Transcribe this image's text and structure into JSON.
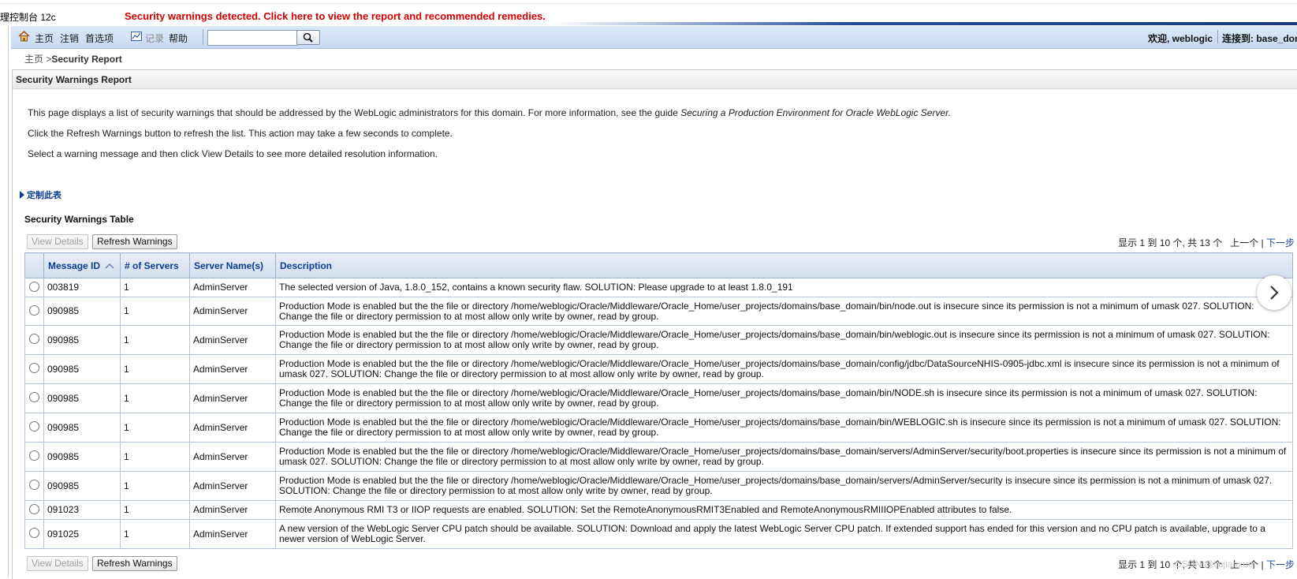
{
  "app": {
    "title": "理控制台 12c",
    "security_alert": "Security warnings detected. Click here to view the report and recommended remedies."
  },
  "menubar": {
    "home": "主页",
    "logout": "注销",
    "preferences": "首选项",
    "record": "记录",
    "help": "帮助",
    "search_value": "",
    "welcome": "欢迎, weblogic",
    "connected": "连接到: base_domain"
  },
  "breadcrumb": {
    "home": "主页",
    "sep": ">",
    "current": "Security Report"
  },
  "panel": {
    "title": "Security Warnings Report"
  },
  "intro": {
    "line1_prefix": "This page displays a list of security warnings that should be addressed by the WebLogic administrators for this domain. For more information, see the guide ",
    "line1_guide": "Securing a Production Environment for Oracle WebLogic Server.",
    "line2": "Click the Refresh Warnings button to refresh the list. This action may take a few seconds to complete.",
    "line3": "Select a warning message and then click View Details to see more detailed resolution information."
  },
  "customize": "定制此表",
  "table": {
    "title": "Security Warnings Table",
    "view_details": "View Details",
    "refresh": "Refresh Warnings",
    "pager_info": "显示 1 到 10 个, 共 13 个",
    "prev": "上一个",
    "pager_sep": "|",
    "next": "下一步",
    "headers": {
      "message_id": "Message ID",
      "servers": "# of Servers",
      "server_names": "Server Name(s)",
      "description": "Description"
    },
    "rows": [
      {
        "id": "003819",
        "servers": "1",
        "server": "AdminServer",
        "desc": "The selected version of Java, 1.8.0_152, contains a known security flaw. SOLUTION: Please upgrade to at least 1.8.0_191"
      },
      {
        "id": "090985",
        "servers": "1",
        "server": "AdminServer",
        "desc": "Production Mode is enabled but the the file or directory /home/weblogic/Oracle/Middleware/Oracle_Home/user_projects/domains/base_domain/bin/node.out is insecure since its permission is not a minimum of umask 027. SOLUTION: Change the file or directory permission to at most allow only write by owner, read by group."
      },
      {
        "id": "090985",
        "servers": "1",
        "server": "AdminServer",
        "desc": "Production Mode is enabled but the the file or directory /home/weblogic/Oracle/Middleware/Oracle_Home/user_projects/domains/base_domain/bin/weblogic.out is insecure since its permission is not a minimum of umask 027. SOLUTION: Change the file or directory permission to at most allow only write by owner, read by group."
      },
      {
        "id": "090985",
        "servers": "1",
        "server": "AdminServer",
        "desc": "Production Mode is enabled but the the file or directory /home/weblogic/Oracle/Middleware/Oracle_Home/user_projects/domains/base_domain/config/jdbc/DataSourceNHIS-0905-jdbc.xml is insecure since its permission is not a minimum of umask 027. SOLUTION: Change the file or directory permission to at most allow only write by owner, read by group."
      },
      {
        "id": "090985",
        "servers": "1",
        "server": "AdminServer",
        "desc": "Production Mode is enabled but the the file or directory /home/weblogic/Oracle/Middleware/Oracle_Home/user_projects/domains/base_domain/bin/NODE.sh is insecure since its permission is not a minimum of umask 027. SOLUTION: Change the file or directory permission to at most allow only write by owner, read by group."
      },
      {
        "id": "090985",
        "servers": "1",
        "server": "AdminServer",
        "desc": "Production Mode is enabled but the the file or directory /home/weblogic/Oracle/Middleware/Oracle_Home/user_projects/domains/base_domain/bin/WEBLOGIC.sh is insecure since its permission is not a minimum of umask 027. SOLUTION: Change the file or directory permission to at most allow only write by owner, read by group."
      },
      {
        "id": "090985",
        "servers": "1",
        "server": "AdminServer",
        "desc": "Production Mode is enabled but the the file or directory /home/weblogic/Oracle/Middleware/Oracle_Home/user_projects/domains/base_domain/servers/AdminServer/security/boot.properties is insecure since its permission is not a minimum of umask 027. SOLUTION: Change the file or directory permission to at most allow only write by owner, read by group."
      },
      {
        "id": "090985",
        "servers": "1",
        "server": "AdminServer",
        "desc": "Production Mode is enabled but the the file or directory /home/weblogic/Oracle/Middleware/Oracle_Home/user_projects/domains/base_domain/servers/AdminServer/security is insecure since its permission is not a minimum of umask 027. SOLUTION: Change the file or directory permission to at most allow only write by owner, read by group."
      },
      {
        "id": "091023",
        "servers": "1",
        "server": "AdminServer",
        "desc": "Remote Anonymous RMI T3 or IIOP requests are enabled. SOLUTION: Set the RemoteAnonymousRMIT3Enabled and RemoteAnonymousRMIIIOPEnabled attributes to false."
      },
      {
        "id": "091025",
        "servers": "1",
        "server": "AdminServer",
        "desc": "A new version of the WebLogic Server CPU patch should be available. SOLUTION: Download and apply the latest WebLogic Server CPU patch. If extended support has ended for this version and no CPU patch is available, upgrade to a newer version of WebLogic Server."
      }
    ]
  },
  "watermark": "CSDN @liujianxue",
  "colors": {
    "alert": "#d40000",
    "link": "#0b3d91",
    "menubar": "#d3e2f6"
  },
  "icons": [
    "home-icon",
    "chart-icon",
    "search-icon",
    "sort-icon",
    "chevron-right-icon",
    "triangle-right-icon"
  ]
}
